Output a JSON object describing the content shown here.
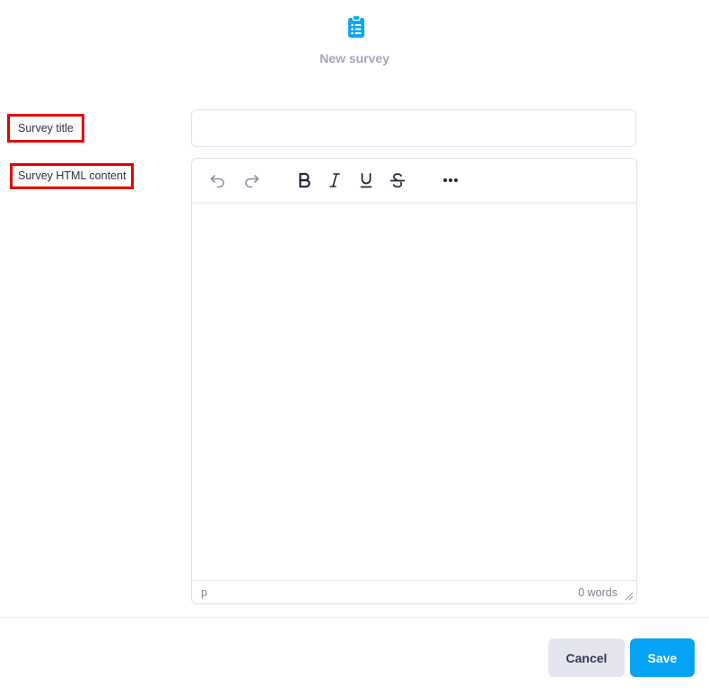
{
  "header": {
    "icon": "clipboard-list-icon",
    "title": "New survey",
    "icon_color": "#0ea5f5"
  },
  "form": {
    "survey_title_label": "Survey title",
    "survey_title_value": "",
    "survey_content_label": "Survey HTML content"
  },
  "editor": {
    "toolbar": {
      "undo": "undo-icon",
      "redo": "redo-icon",
      "bold": "bold-icon",
      "italic": "italic-icon",
      "underline": "underline-icon",
      "strikethrough": "strikethrough-icon",
      "more": "more-icon"
    },
    "content": "",
    "status_path": "p",
    "word_count": "0 words"
  },
  "footer": {
    "cancel_label": "Cancel",
    "save_label": "Save"
  },
  "colors": {
    "accent": "#07a3f5",
    "highlight_border": "#e60000",
    "cancel_bg": "#e4e5ef"
  }
}
